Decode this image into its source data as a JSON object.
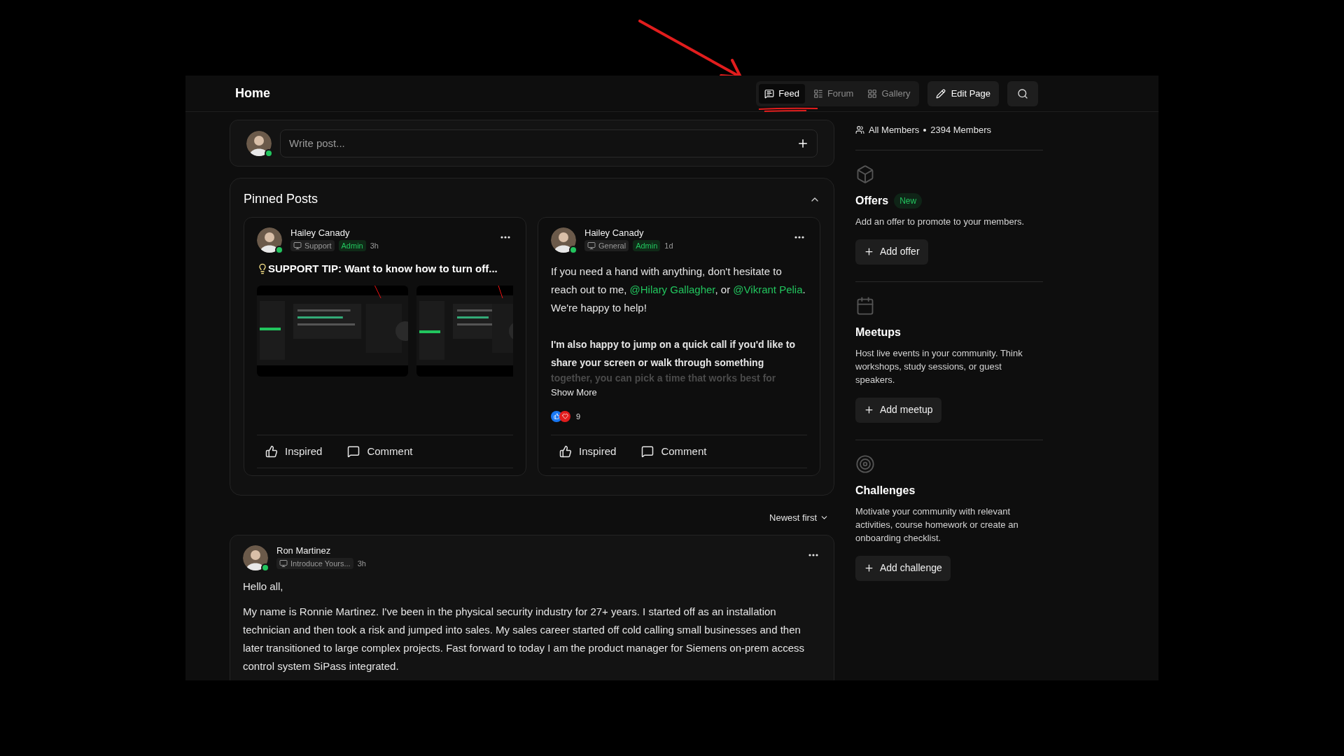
{
  "header": {
    "title": "Home",
    "tabs": [
      {
        "label": "Feed",
        "selected": true
      },
      {
        "label": "Forum",
        "selected": false
      },
      {
        "label": "Gallery",
        "selected": false
      }
    ],
    "edit_button": "Edit Page"
  },
  "composer": {
    "placeholder": "Write post...",
    "online": true
  },
  "pinned": {
    "title": "Pinned Posts",
    "expanded": true,
    "posts": [
      {
        "author": "Hailey Canady",
        "online": true,
        "space": "Support",
        "role": "Admin",
        "time": "3h",
        "title": "SUPPORT TIP: Want to know how to turn off...",
        "images": [
          {
            "kind": "picture"
          },
          {
            "kind": "picture"
          }
        ],
        "actions": [
          "Inspired",
          "Comment"
        ]
      },
      {
        "author": "Hailey Canady",
        "online": true,
        "space": "General",
        "role": "Admin",
        "time": "1d",
        "body": [
          {
            "kind": "text",
            "text": "If you need a hand with anything, don't hesitate to reach out to me, "
          },
          {
            "kind": "mention",
            "text": "@Hilary Gallagher"
          },
          {
            "kind": "text",
            "text": ", or "
          },
          {
            "kind": "mention",
            "text": "@Vikrant Pelia"
          },
          {
            "kind": "text",
            "text": ". We're happy to help!"
          }
        ],
        "bold_text": "I'm also happy to jump on a quick call if you'd like to share your screen or walk through something",
        "faded_text": "together, you can pick a time that works best for",
        "show_more": "Show More",
        "reaction_count": "9",
        "actions": [
          "Inspired",
          "Comment"
        ]
      }
    ]
  },
  "sort": "Newest first",
  "feed": [
    {
      "author": "Ron Martinez",
      "online": true,
      "space": "Introduce Yours...",
      "time": "3h",
      "paragraphs": [
        "Hello all,",
        "My name is Ronnie Martinez. I've been in the physical security industry for 27+ years. I started off as an installation technician and then took a risk and jumped into sales. My sales career started off cold calling small businesses and then later transitioned to large complex projects. Fast forward to today I am the product manager for Siemens on-prem access control system SiPass integrated."
      ]
    }
  ],
  "sidebar": {
    "members": {
      "label": "All Members",
      "count": "2394 Members"
    },
    "sections": [
      {
        "title": "Offers",
        "badge": "New",
        "description": "Add an offer to promote to your members.",
        "button": "Add offer"
      },
      {
        "title": "Meetups",
        "description": "Host live events in your community. Think workshops, study sessions, or guest speakers.",
        "button": "Add meetup"
      },
      {
        "title": "Challenges",
        "description": "Motivate your community with relevant activities, course homework or create an onboarding checklist.",
        "button": "Add challenge"
      }
    ]
  }
}
